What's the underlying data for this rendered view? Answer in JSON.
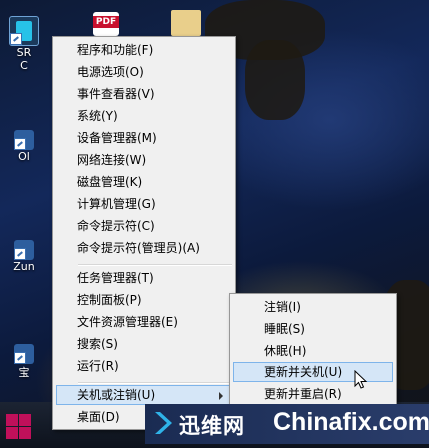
{
  "desktop": {
    "icons": [
      {
        "name": "SRWare Iron",
        "label": "SR",
        "label2": "C"
      },
      {
        "name": "pdf",
        "label": "PDF"
      },
      {
        "name": "folder",
        "label": ""
      },
      {
        "name": "oracle",
        "label": "Ol"
      },
      {
        "name": "zune",
        "label": "Zun"
      },
      {
        "name": "bao",
        "label": "宝"
      }
    ]
  },
  "winx_menu": {
    "items": [
      {
        "label": "程序和功能(F)"
      },
      {
        "label": "电源选项(O)"
      },
      {
        "label": "事件查看器(V)"
      },
      {
        "label": "系统(Y)"
      },
      {
        "label": "设备管理器(M)"
      },
      {
        "label": "网络连接(W)"
      },
      {
        "label": "磁盘管理(K)"
      },
      {
        "label": "计算机管理(G)"
      },
      {
        "label": "命令提示符(C)"
      },
      {
        "label": "命令提示符(管理员)(A)"
      },
      {
        "label": "任务管理器(T)"
      },
      {
        "label": "控制面板(P)"
      },
      {
        "label": "文件资源管理器(E)"
      },
      {
        "label": "搜索(S)"
      },
      {
        "label": "运行(R)"
      },
      {
        "label": "关机或注销(U)"
      },
      {
        "label": "桌面(D)"
      }
    ]
  },
  "submenu": {
    "items": [
      {
        "label": "注销(I)"
      },
      {
        "label": "睡眠(S)"
      },
      {
        "label": "休眠(H)"
      },
      {
        "label": "更新并关机(U)"
      },
      {
        "label": "更新并重启(R)"
      }
    ]
  },
  "watermark": {
    "cn": "迅维网",
    "en": "Chinafix.com"
  },
  "colors": {
    "highlight_bg": "#d5e6f7",
    "highlight_border": "#7eb4ea",
    "start_red": "#c0105a"
  }
}
